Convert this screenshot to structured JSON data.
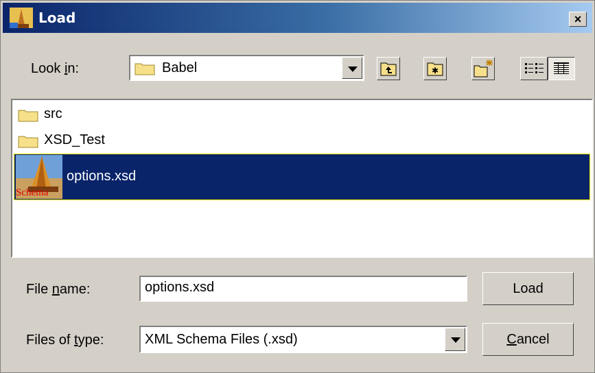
{
  "window": {
    "title": "Load",
    "close_label": "×"
  },
  "lookin": {
    "label_pre": "Look ",
    "label_u": "i",
    "label_post": "n:",
    "value": "Babel"
  },
  "toolbar": {
    "buttons": [
      {
        "icon": "up-one-level-icon"
      },
      {
        "icon": "home-folder-icon"
      },
      {
        "icon": "new-folder-icon"
      },
      {
        "icon": "list-view-icon"
      },
      {
        "icon": "details-view-icon"
      }
    ]
  },
  "files": [
    {
      "name": "src",
      "type": "folder",
      "selected": false
    },
    {
      "name": "XSD_Test",
      "type": "folder",
      "selected": false
    },
    {
      "name": "options.xsd",
      "type": "xsd-file",
      "selected": true,
      "icon_text": "Schema"
    }
  ],
  "filename": {
    "label_pre": "File ",
    "label_u": "n",
    "label_post": "ame:",
    "value": "options.xsd"
  },
  "filetype": {
    "label_pre": "Files of ",
    "label_u": "t",
    "label_post": "ype:",
    "value": "XML Schema Files (.xsd)"
  },
  "buttons": {
    "load_label": "Load",
    "cancel_u": "C",
    "cancel_rest": "ancel"
  }
}
